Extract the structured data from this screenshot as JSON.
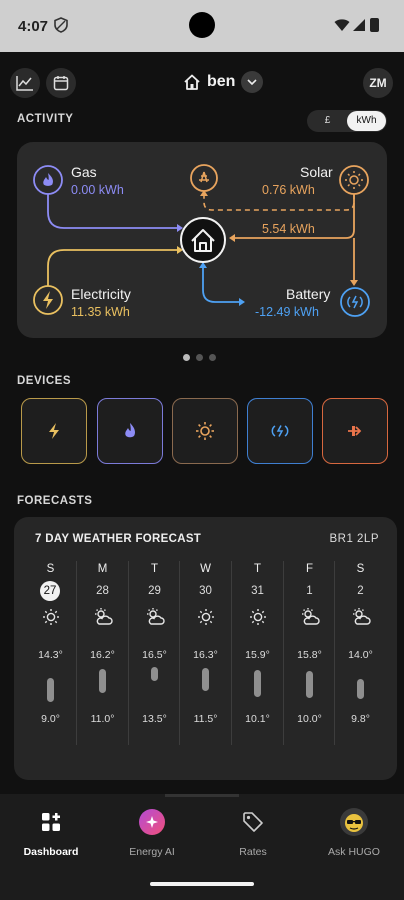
{
  "status_bar": {
    "time": "4:07"
  },
  "header": {
    "home_name": "ben",
    "user_initials": "ZM"
  },
  "activity": {
    "section_title": "ACTIVITY",
    "unit_options": [
      "£",
      "kWh"
    ],
    "selected_unit": "kWh",
    "nodes": {
      "gas": {
        "label": "Gas",
        "value": "0.00 kWh",
        "color": "#8d8cf5"
      },
      "solar": {
        "label": "Solar",
        "value": "0.76 kWh",
        "color": "#e8a45e"
      },
      "electricity": {
        "label": "Electricity",
        "value": "11.35 kWh",
        "color": "#e9c060"
      },
      "battery": {
        "label": "Battery",
        "value": "-12.49 kWh",
        "color": "#4ea1f3"
      },
      "solar_to_home": {
        "value": "5.54 kWh"
      }
    },
    "page_count": 3,
    "active_page": 0
  },
  "devices": {
    "section_title": "DEVICES",
    "items": [
      {
        "icon": "bolt-icon",
        "color": "#d9b654"
      },
      {
        "icon": "flame-icon",
        "color": "#8d8cf5"
      },
      {
        "icon": "sun-icon",
        "color": "#d99a5a"
      },
      {
        "icon": "battery-cycle-icon",
        "color": "#3f7fd1"
      },
      {
        "icon": "export-icon",
        "color": "#e9744b"
      }
    ]
  },
  "forecasts": {
    "section_title": "FORECASTS",
    "card_title": "7 DAY WEATHER FORECAST",
    "postcode": "BR1 2LP",
    "days": [
      {
        "dow": "S",
        "date": "27",
        "icon": "sun-icon",
        "high": "14.3°",
        "low": "9.0°",
        "today": true
      },
      {
        "dow": "M",
        "date": "28",
        "icon": "sun-cloud-icon",
        "high": "16.2°",
        "low": "11.0°",
        "today": false
      },
      {
        "dow": "T",
        "date": "29",
        "icon": "sun-cloud-icon",
        "high": "16.5°",
        "low": "13.5°",
        "today": false
      },
      {
        "dow": "W",
        "date": "30",
        "icon": "sun-icon",
        "high": "16.3°",
        "low": "11.5°",
        "today": false
      },
      {
        "dow": "T",
        "date": "31",
        "icon": "sun-icon",
        "high": "15.9°",
        "low": "10.1°",
        "today": false
      },
      {
        "dow": "F",
        "date": "1",
        "icon": "sun-cloud-icon",
        "high": "15.8°",
        "low": "10.0°",
        "today": false
      },
      {
        "dow": "S",
        "date": "2",
        "icon": "sun-cloud-icon",
        "high": "14.0°",
        "low": "9.8°",
        "today": false
      }
    ]
  },
  "nav": {
    "items": [
      {
        "label": "Dashboard",
        "active": true
      },
      {
        "label": "Energy AI",
        "active": false
      },
      {
        "label": "Rates",
        "active": false
      },
      {
        "label": "Ask HUGO",
        "active": false
      }
    ]
  }
}
